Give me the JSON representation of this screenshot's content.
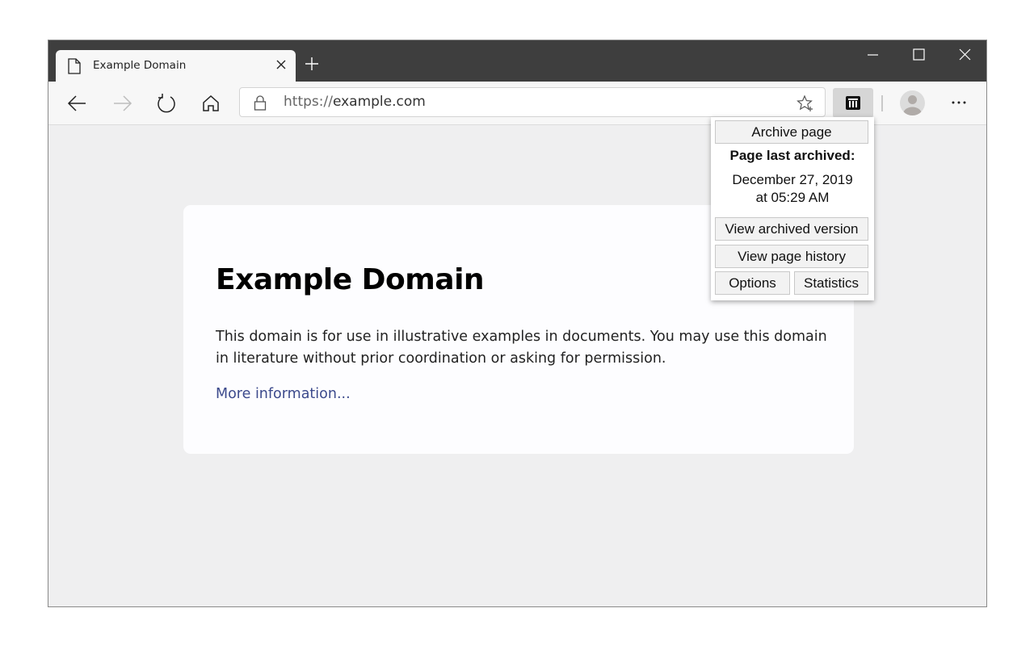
{
  "browser": {
    "tab": {
      "title": "Example Domain",
      "icon": "document-icon",
      "close_icon": "close-icon"
    },
    "new_tab_icon": "plus-icon",
    "window_controls": [
      "minimize-icon",
      "maximize-icon",
      "close-icon"
    ],
    "nav": [
      "back-icon",
      "forward-icon",
      "refresh-icon",
      "home-icon"
    ],
    "address_bar": {
      "scheme": "https://",
      "host": "example.com",
      "lock_icon": "lock-icon",
      "favorite_icon": "star-plus-icon"
    },
    "extension_icon": "archive-icon",
    "profile_icon": "avatar-icon",
    "menu_icon": "more-icon"
  },
  "page": {
    "heading": "Example Domain",
    "paragraph": "This domain is for use in illustrative examples in documents. You may use this domain in literature without prior coordination or asking for permission.",
    "link": "More information..."
  },
  "popup": {
    "archive_button": "Archive page",
    "last_archived_label": "Page last archived:",
    "last_archived_date": "December 27, 2019",
    "last_archived_time": "at 05:29 AM",
    "view_archived_button": "View archived version",
    "view_history_button": "View page history",
    "options_button": "Options",
    "statistics_button": "Statistics"
  }
}
